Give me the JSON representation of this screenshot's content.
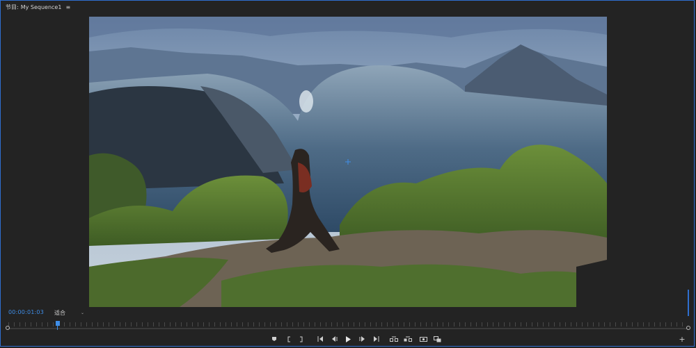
{
  "panel": {
    "title_prefix": "节目:",
    "sequence_name": "My Sequence1",
    "menu_icon": "≡"
  },
  "viewer": {
    "content": "warped mountain landscape with a lake and a woman standing on a grassy hilltop"
  },
  "controls": {
    "timecode": "00:00:01:03",
    "fit_label": "适合",
    "fit_chevron": "⌄"
  },
  "transport": {
    "buttons": [
      {
        "name": "add-marker-icon"
      },
      {
        "name": "mark-in-icon"
      },
      {
        "name": "mark-out-icon"
      },
      {
        "name": "go-to-in-icon"
      },
      {
        "name": "step-back-icon"
      },
      {
        "name": "play-icon"
      },
      {
        "name": "step-forward-icon"
      },
      {
        "name": "go-to-out-icon"
      },
      {
        "name": "lift-icon"
      },
      {
        "name": "extract-icon"
      },
      {
        "name": "export-frame-icon"
      },
      {
        "name": "comparison-view-icon"
      },
      {
        "name": "add-button-icon"
      }
    ],
    "add_button": "+"
  },
  "colors": {
    "accent": "#3f8ee8",
    "panel_border": "#2f6fd0",
    "background": "#232323"
  }
}
